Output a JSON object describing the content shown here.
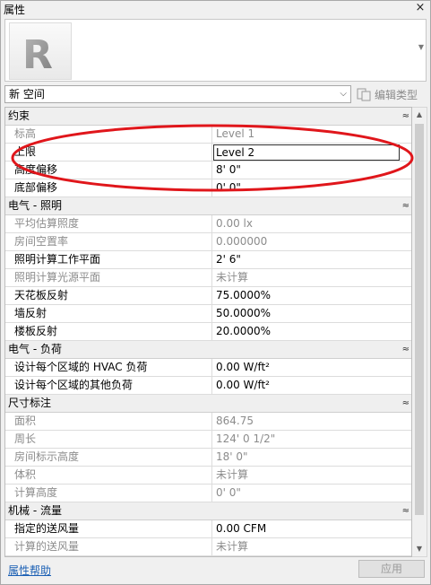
{
  "window": {
    "title": "属性",
    "close_glyph": "×"
  },
  "type_selector": {
    "logo_letter": "R",
    "selected": "新 空间",
    "edit_type_label": "编辑类型"
  },
  "groups": [
    {
      "name": "约束",
      "rows": [
        {
          "key": "标高",
          "value": "Level 1",
          "readonly": true
        },
        {
          "key": "上限",
          "value": "Level 2",
          "readonly": false,
          "editing": true
        },
        {
          "key": "高度偏移",
          "value": "8'  0\"",
          "readonly": false
        },
        {
          "key": "底部偏移",
          "value": "0'  0\"",
          "readonly": false
        }
      ]
    },
    {
      "name": "电气 - 照明",
      "rows": [
        {
          "key": "平均估算照度",
          "value": "0.00 lx",
          "readonly": true
        },
        {
          "key": "房间空置率",
          "value": "0.000000",
          "readonly": true
        },
        {
          "key": "照明计算工作平面",
          "value": "2'  6\"",
          "readonly": false
        },
        {
          "key": "照明计算光源平面",
          "value": "未计算",
          "readonly": true
        },
        {
          "key": "天花板反射",
          "value": "75.0000%",
          "readonly": false
        },
        {
          "key": "墙反射",
          "value": "50.0000%",
          "readonly": false
        },
        {
          "key": "楼板反射",
          "value": "20.0000%",
          "readonly": false
        }
      ]
    },
    {
      "name": "电气 - 负荷",
      "rows": [
        {
          "key": "设计每个区域的 HVAC 负荷",
          "value": "0.00 W/ft²",
          "readonly": false
        },
        {
          "key": "设计每个区域的其他负荷",
          "value": "0.00 W/ft²",
          "readonly": false
        }
      ]
    },
    {
      "name": "尺寸标注",
      "rows": [
        {
          "key": "面积",
          "value": "864.75",
          "readonly": true
        },
        {
          "key": "周长",
          "value": "124'  0 1/2\"",
          "readonly": true
        },
        {
          "key": "房间标示高度",
          "value": "18'  0\"",
          "readonly": true
        },
        {
          "key": "体积",
          "value": "未计算",
          "readonly": true
        },
        {
          "key": "计算高度",
          "value": "0'  0\"",
          "readonly": true
        }
      ]
    },
    {
      "name": "机械 - 流量",
      "rows": [
        {
          "key": "指定的送风量",
          "value": "0.00 CFM",
          "readonly": false
        },
        {
          "key": "计算的送风量",
          "value": "未计算",
          "readonly": true
        }
      ]
    }
  ],
  "collapse_glyph": "≈",
  "footer": {
    "help_link": "属性帮助",
    "apply_label": "应用"
  },
  "annotation_color": "#e0161b"
}
